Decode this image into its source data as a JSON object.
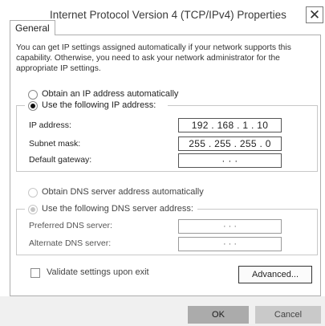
{
  "window": {
    "title": "Internet Protocol Version 4 (TCP/IPv4) Properties",
    "close_glyph": "✕"
  },
  "tabs": [
    {
      "label": "General"
    }
  ],
  "intro_text": "You can get IP settings assigned automatically if your network supports this capability. Otherwise, you need to ask your network administrator for the appropriate IP settings.",
  "ip_section": {
    "auto_label": "Obtain an IP address automatically",
    "manual_label": "Use the following IP address:",
    "selected": "manual",
    "fields": [
      {
        "label": "IP address:",
        "value": "192 . 168 . 1 . 10"
      },
      {
        "label": "Subnet mask:",
        "value": "255 . 255 . 255 . 0"
      },
      {
        "label": "Default gateway:",
        "value": "·      ·      ·"
      }
    ]
  },
  "dns_section": {
    "auto_label": "Obtain DNS server address automatically",
    "manual_label": "Use the following DNS server address:",
    "selected": "manual",
    "fields": [
      {
        "label": "Preferred DNS server:",
        "value": "·      ·      ·"
      },
      {
        "label": "Alternate DNS server:",
        "value": "·      ·      ·"
      }
    ]
  },
  "validate": {
    "label": "Validate settings upon exit",
    "checked": false
  },
  "buttons": {
    "advanced": "Advanced...",
    "ok": "OK",
    "cancel": "Cancel"
  }
}
